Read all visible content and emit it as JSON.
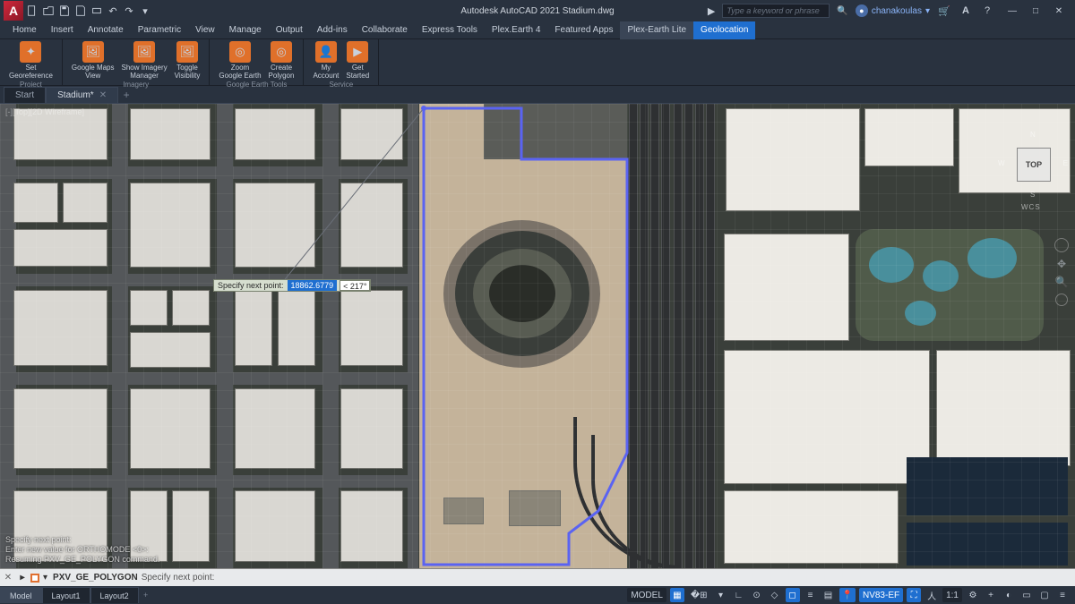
{
  "title": "Autodesk AutoCAD 2021   Stadium.dwg",
  "search_placeholder": "Type a keyword or phrase",
  "user": "chanakoulas",
  "menus": [
    "Home",
    "Insert",
    "Annotate",
    "Parametric",
    "View",
    "Manage",
    "Output",
    "Add-ins",
    "Collaborate",
    "Express Tools",
    "Plex.Earth 4",
    "Featured Apps",
    "Plex-Earth Lite",
    "Geolocation"
  ],
  "menu_active_a": 12,
  "menu_active_b": 13,
  "ribbon_panels": [
    {
      "title": "Project",
      "buttons": [
        {
          "label": "Set\nGeoreference",
          "icon": "✦",
          "bg": "#e0702a"
        }
      ]
    },
    {
      "title": "Imagery",
      "buttons": [
        {
          "label": "Google Maps\nView",
          "icon": "🖼",
          "bg": "#e0702a"
        },
        {
          "label": "Show Imagery\nManager",
          "icon": "🖼",
          "bg": "#e0702a"
        },
        {
          "label": "Toggle\nVisibility",
          "icon": "🖼",
          "bg": "#e0702a"
        }
      ]
    },
    {
      "title": "Google Earth Tools",
      "buttons": [
        {
          "label": "Zoom\nGoogle Earth",
          "icon": "◎",
          "bg": "#e0702a"
        },
        {
          "label": "Create\nPolygon",
          "icon": "◎",
          "bg": "#e0702a"
        }
      ]
    },
    {
      "title": "Service",
      "buttons": [
        {
          "label": "My\nAccount",
          "icon": "👤",
          "bg": "#e0702a"
        },
        {
          "label": "Get\nStarted",
          "icon": "▶",
          "bg": "#e0702a"
        }
      ]
    }
  ],
  "doc_tabs": [
    {
      "label": "Start",
      "active": false,
      "closable": false
    },
    {
      "label": "Stadium*",
      "active": true,
      "closable": true
    }
  ],
  "viewport_label": "[-][Top][2D Wireframe]",
  "tooltip": {
    "label": "Specify next point:",
    "distance": "18862.6779",
    "angle": "< 217°"
  },
  "viewcube": {
    "face": "TOP",
    "n": "N",
    "s": "S",
    "e": "E",
    "w": "W",
    "wcs": "WCS"
  },
  "cmd_history": [
    "Specify next point:",
    "Enter new value for ORTHOMODE <0>:",
    "Resuming PXV_GE_POLYGON command."
  ],
  "cmdline": {
    "name": "PXV_GE_POLYGON",
    "prompt": "Specify next point:"
  },
  "layout_tabs": [
    "Model",
    "Layout1",
    "Layout2"
  ],
  "layout_active": 0,
  "status": {
    "model": "MODEL",
    "coord_sys": "NV83-EF",
    "scale": "1:1"
  }
}
